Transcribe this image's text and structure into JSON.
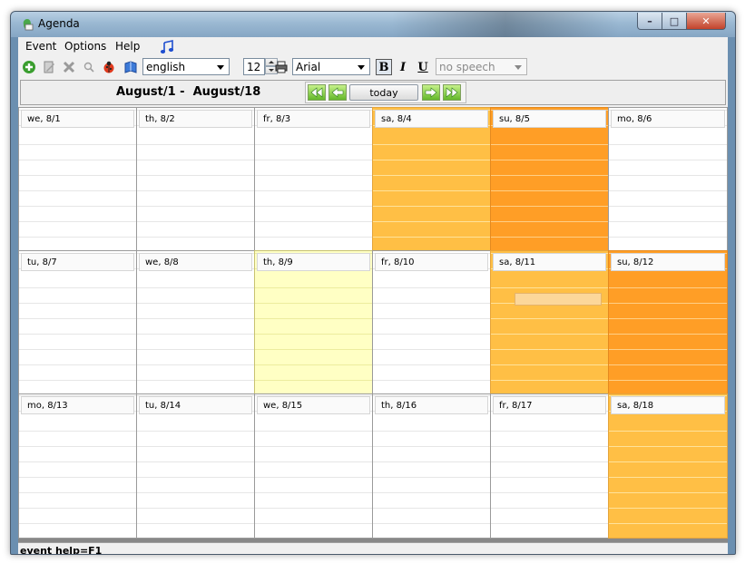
{
  "window": {
    "title": "Agenda",
    "controls": {
      "minimize": "–",
      "maximize": "□",
      "close": "✕"
    }
  },
  "menu": [
    {
      "label": "Event"
    },
    {
      "label": "Options"
    },
    {
      "label": "Help"
    }
  ],
  "toolbar": {
    "language": "english",
    "font_size": "12",
    "font_name": "Arial",
    "bold": "B",
    "italic": "I",
    "underline": "U",
    "speech": "no speech"
  },
  "nav": {
    "range_start": "August/1 -",
    "range_end": "August/18",
    "today_label": "today"
  },
  "days": [
    {
      "label": "we, 8/1",
      "color": "white"
    },
    {
      "label": "th, 8/2",
      "color": "white"
    },
    {
      "label": "fr, 8/3",
      "color": "white"
    },
    {
      "label": "sa, 8/4",
      "color": "amber"
    },
    {
      "label": "su, 8/5",
      "color": "orange"
    },
    {
      "label": "mo, 8/6",
      "color": "white"
    },
    {
      "label": "tu, 8/7",
      "color": "white"
    },
    {
      "label": "we, 8/8",
      "color": "white"
    },
    {
      "label": "th, 8/9",
      "color": "light"
    },
    {
      "label": "fr, 8/10",
      "color": "white"
    },
    {
      "label": "sa, 8/11",
      "color": "amber",
      "has_event": true
    },
    {
      "label": "su, 8/12",
      "color": "orange"
    },
    {
      "label": "mo, 8/13",
      "color": "white"
    },
    {
      "label": "tu, 8/14",
      "color": "white"
    },
    {
      "label": "we, 8/15",
      "color": "white"
    },
    {
      "label": "th, 8/16",
      "color": "white"
    },
    {
      "label": "fr, 8/17",
      "color": "white"
    },
    {
      "label": "sa, 8/18",
      "color": "amber"
    }
  ],
  "status": {
    "text": "event help=F1"
  },
  "colors": {
    "weekend_saturday": "#ffbf45",
    "weekend_sunday": "#ff9e26",
    "today": "#ffffc4"
  }
}
